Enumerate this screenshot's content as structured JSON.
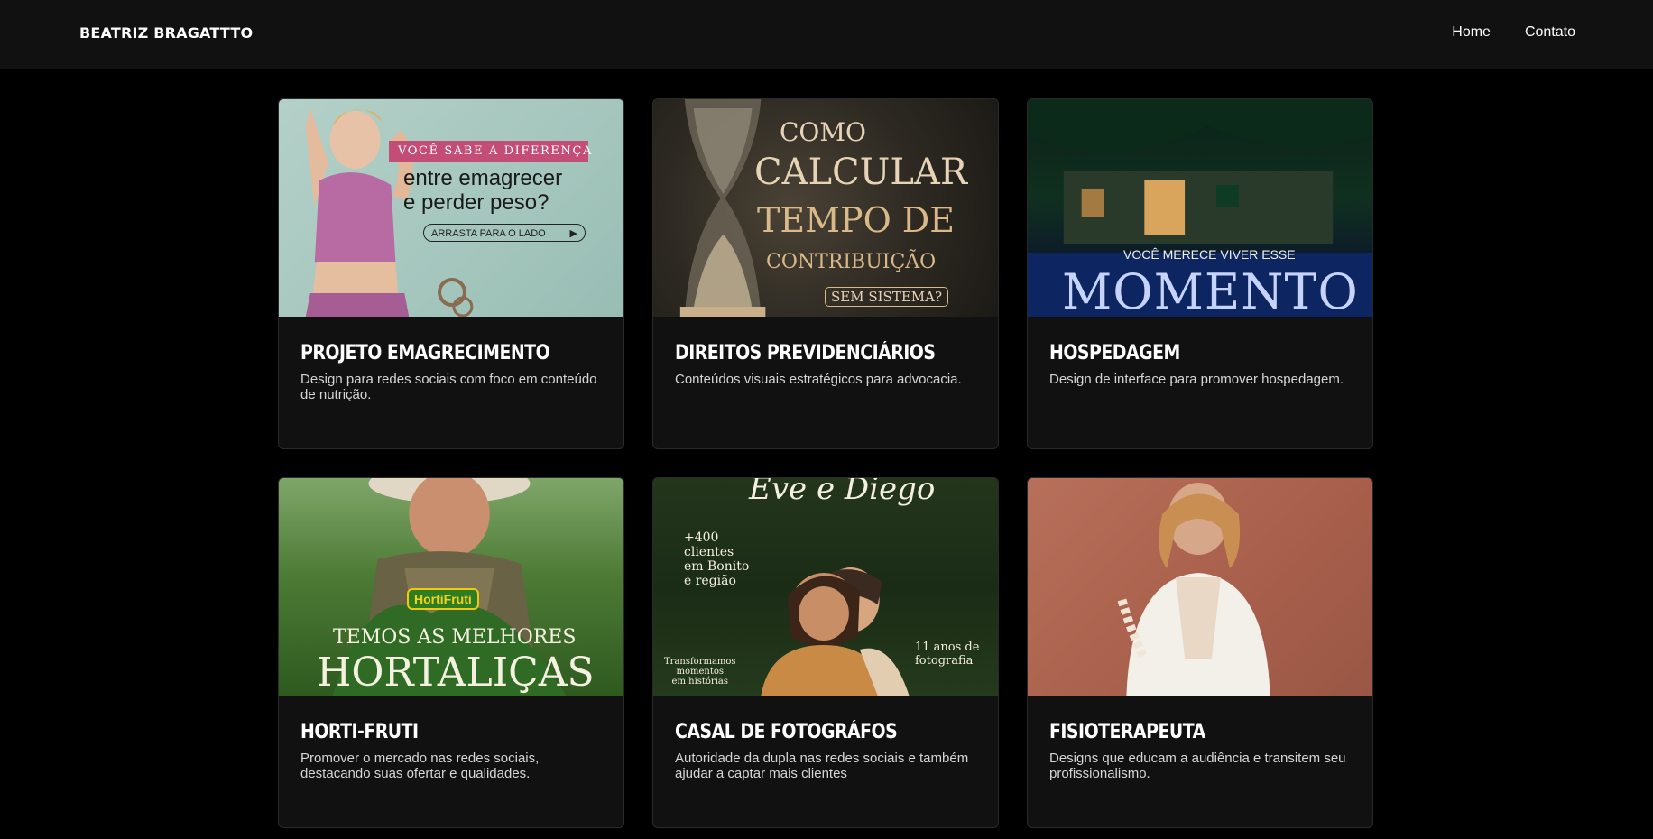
{
  "header": {
    "brand": "BEATRIZ BRAGATTTO",
    "nav": [
      {
        "label": "Home"
      },
      {
        "label": "Contato"
      }
    ]
  },
  "cards": [
    {
      "title": "PROJETO EMAGRECIMENTO",
      "description": "Design para redes sociais com foco em conteúdo de nutrição.",
      "image_text": {
        "line1": "VOCÊ SABE A DIFERENÇA",
        "line2": "entre emagrecer",
        "line3": "e perder peso?",
        "cta": "ARRASTA PARA O LADO"
      }
    },
    {
      "title": "DIREITOS PREVIDENCIÁRIOS",
      "description": "Conteúdos visuais estratégicos para advocacia.",
      "image_text": {
        "line1": "COMO",
        "line2": "CALCULAR",
        "line3": "TEMPO DE",
        "line4": "CONTRIBUIÇÃO",
        "line5": "SEM SISTEMA?"
      }
    },
    {
      "title": "HOSPEDAGEM",
      "description": "Design de interface para promover hospedagem.",
      "image_text": {
        "line1": "VOCÊ MERECE VIVER ESSE",
        "line2": "MOMENTO"
      }
    },
    {
      "title": "HORTI-FRUTI",
      "description": "Promover o mercado nas redes sociais, destacando suas ofertar e qualidades.",
      "image_text": {
        "logo": "HortiFruti",
        "line1": "TEMOS AS MELHORES",
        "line2": "HORTALIÇAS"
      }
    },
    {
      "title": "CASAL DE FOTOGRÁFOS",
      "description": "Autoridade da dupla nas redes sociais e também ajudar a captar mais clientes",
      "image_text": {
        "heading": "Eve e Diego",
        "left1": "+400",
        "left2": "clientes",
        "left3": "em Bonito",
        "left4": "e região",
        "right1": "11 anos de",
        "right2": "fotografia",
        "bottom1": "Transformamos",
        "bottom2": "momentos",
        "bottom3": "em histórias"
      }
    },
    {
      "title": "FISIOTERAPEUTA",
      "description": "Designs que educam a audiência e transitem seu profissionalismo.",
      "image_text": {}
    }
  ]
}
